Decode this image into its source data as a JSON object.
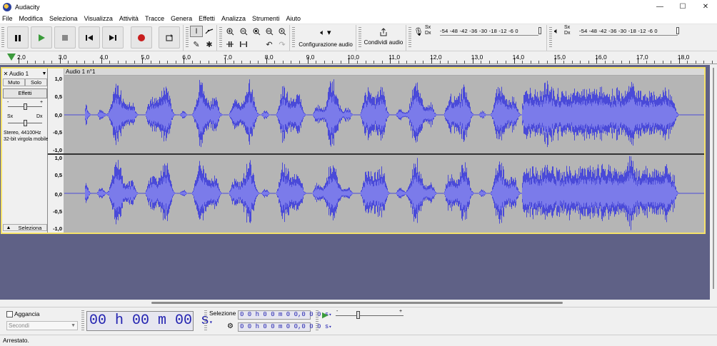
{
  "window": {
    "title": "Audacity",
    "minimize": "—",
    "maximize": "☐",
    "close": "✕"
  },
  "menu": [
    "File",
    "Modifica",
    "Seleziona",
    "Visualizza",
    "Attività",
    "Tracce",
    "Genera",
    "Effetti",
    "Analizza",
    "Strumenti",
    "Aiuto"
  ],
  "toolbar": {
    "audio_setup_label": "Configurazione audio",
    "share_audio_label": "Condividi audio",
    "meter_rec_channels": [
      "Sx",
      "Dx"
    ],
    "meter_play_channels": [
      "Sx",
      "Dx"
    ],
    "meter_scale": "-54 -48 -42 -36 -30 -18 -12  -6  0"
  },
  "ruler": {
    "labels": [
      "2,0",
      "3,0",
      "4,0",
      "5,0",
      "6,0",
      "7,0",
      "8,0",
      "9,0",
      "10,0",
      "11,0",
      "12,0",
      "13,0",
      "14,0",
      "15,0",
      "16,0",
      "17,0",
      "18,0"
    ]
  },
  "track": {
    "name": "Audio 1",
    "clip_name": "Audio 1 n°1",
    "mute_label": "Muto",
    "solo_label": "Solo",
    "effects_label": "Effetti",
    "gain_min": "-",
    "gain_max": "+",
    "pan_left": "Sx",
    "pan_right": "Dx",
    "info_line1": "Stereo, 44100Hz",
    "info_line2": "32-bit virgola mobile",
    "select_label": "Seleziona",
    "y_labels": [
      "1,0",
      "0,5",
      "0,0",
      "-0,5",
      "-1,0"
    ]
  },
  "bottom": {
    "snap_label": "Aggancia",
    "snap_unit": "Secondi",
    "time_display": "00 h 00 m 00 s",
    "selection_label": "Selezione",
    "sel_start": "0 0 h 0 0 m 0 0,0 0 0 s",
    "sel_end": "0 0 h 0 0 m 0 0,0 0 0 s",
    "speed_min": "-",
    "speed_max": "+"
  },
  "status": {
    "text": "Arrestato."
  },
  "colors": {
    "waveform": "#4a4ad8",
    "waveform_rms": "#7b7bea",
    "track_bg": "#b5b5b5",
    "track_border": "#f5e26a",
    "empty_area": "#5f6186",
    "record": "#c81e1e",
    "play": "#3a9b3a"
  }
}
